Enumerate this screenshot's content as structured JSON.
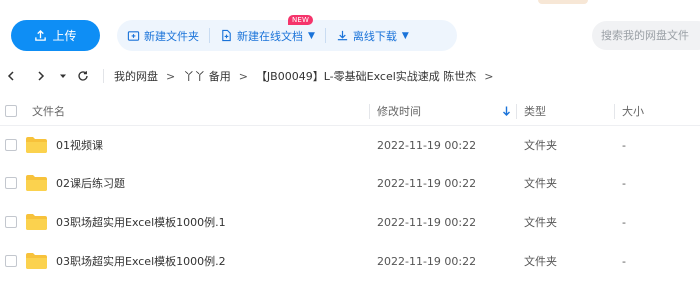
{
  "toolbar": {
    "upload_label": "上传",
    "actions": [
      {
        "label": "新建文件夹",
        "icon": "new-folder-icon"
      },
      {
        "label": "新建在线文档",
        "icon": "new-doc-icon",
        "badge": "NEW",
        "caret": "▼"
      },
      {
        "label": "离线下载",
        "icon": "offline-download-icon",
        "caret": "▼"
      }
    ]
  },
  "search": {
    "placeholder": "搜索我的网盘文件"
  },
  "breadcrumb": {
    "items": [
      "我的网盘",
      "丫丫 备用",
      "【JB00049】L-零基础Excel实战速成 陈世杰"
    ],
    "separator": ">"
  },
  "table": {
    "columns": {
      "name": "文件名",
      "mtime": "修改时间",
      "type": "类型",
      "size": "大小"
    },
    "rows": [
      {
        "name": "01视频课",
        "mtime": "2022-11-19 00:22",
        "type": "文件夹",
        "size": "-"
      },
      {
        "name": "02课后练习题",
        "mtime": "2022-11-19 00:22",
        "type": "文件夹",
        "size": "-"
      },
      {
        "name": "03职场超实用Excel模板1000例.1",
        "mtime": "2022-11-19 00:22",
        "type": "文件夹",
        "size": "-"
      },
      {
        "name": "03职场超实用Excel模板1000例.2",
        "mtime": "2022-11-19 00:22",
        "type": "文件夹",
        "size": "-"
      }
    ]
  },
  "colors": {
    "accent": "#0e8ef5",
    "action_bg": "#eef5fd",
    "action_text": "#1a73d9",
    "folder": "#f7c23b",
    "badge": "#f5346b"
  }
}
